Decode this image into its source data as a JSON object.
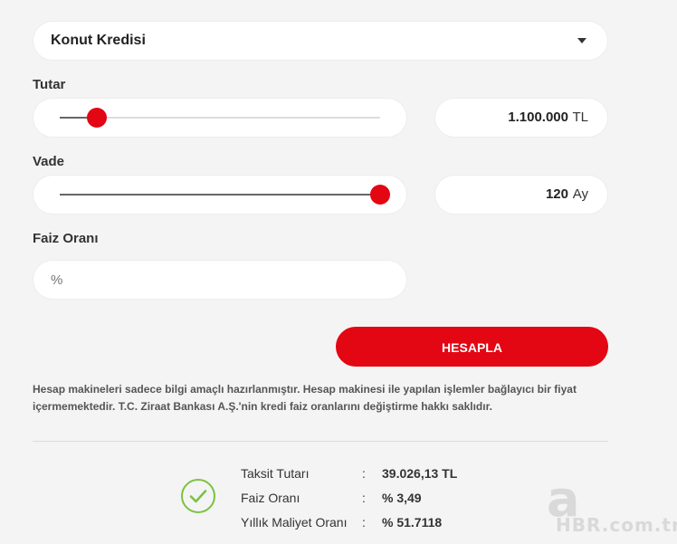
{
  "loan_type": {
    "selected": "Konut Kredisi"
  },
  "amount": {
    "label": "Tutar",
    "value": "1.100.000",
    "unit": "TL",
    "slider_fraction": 0.116
  },
  "term": {
    "label": "Vade",
    "value": "120",
    "unit": "Ay",
    "slider_fraction": 1.0
  },
  "rate": {
    "label": "Faiz Oranı",
    "placeholder": "%"
  },
  "calculate_button": "HESAPLA",
  "disclaimer": "Hesap makineleri sadece bilgi amaçlı hazırlanmıştır. Hesap makinesi ile yapılan işlemler bağlayıcı bir fiyat içermemektedir. T.C. Ziraat Bankası A.Ş.'nin kredi faiz oranlarını değiştirme hakkı saklıdır.",
  "results": {
    "rows": [
      {
        "label": "Taksit Tutarı",
        "sep": ":",
        "value": "39.026,13 TL"
      },
      {
        "label": "Faiz Oranı",
        "sep": ":",
        "value": "% 3,49"
      },
      {
        "label": "Yıllık Maliyet Oranı",
        "sep": ":",
        "value": "% 51.7118"
      }
    ]
  },
  "watermark": {
    "letter": "a",
    "text": "HBR.com.tr"
  },
  "colors": {
    "accent": "#e30613",
    "success": "#7cc242",
    "background": "#f4f4f4"
  }
}
